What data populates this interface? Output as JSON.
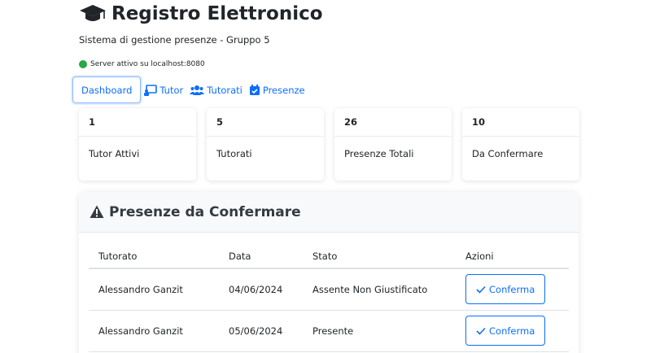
{
  "header": {
    "title": "Registro Elettronico",
    "title_icon": "graduation-cap-icon",
    "subtitle": "Sistema di gestione presenze - Gruppo 5",
    "server_status": "Server attivo su localhost:8080",
    "server_status_color": "#28a745"
  },
  "nav": {
    "items": [
      {
        "label": "Dashboard",
        "icon": "",
        "active": true
      },
      {
        "label": "Tutor",
        "icon": "chalkboard-icon",
        "active": false
      },
      {
        "label": "Tutorati",
        "icon": "users-icon",
        "active": false
      },
      {
        "label": "Presenze",
        "icon": "calendar-check-icon",
        "active": false
      }
    ],
    "accent_color": "#0d6efd"
  },
  "stats": [
    {
      "value": "1",
      "label": "Tutor Attivi"
    },
    {
      "value": "5",
      "label": "Tutorati"
    },
    {
      "value": "26",
      "label": "Presenze Totali"
    },
    {
      "value": "10",
      "label": "Da Confermare"
    }
  ],
  "pending": {
    "title": "Presenze da Confermare",
    "title_icon": "warning-icon",
    "columns": [
      "Tutorato",
      "Data",
      "Stato",
      "Azioni"
    ],
    "rows": [
      {
        "tutorato": "Alessandro Ganzit",
        "data": "04/06/2024",
        "stato": "Assente Non Giustificato",
        "azione": "Conferma"
      },
      {
        "tutorato": "Alessandro Ganzit",
        "data": "05/06/2024",
        "stato": "Presente",
        "azione": "Conferma"
      }
    ]
  }
}
